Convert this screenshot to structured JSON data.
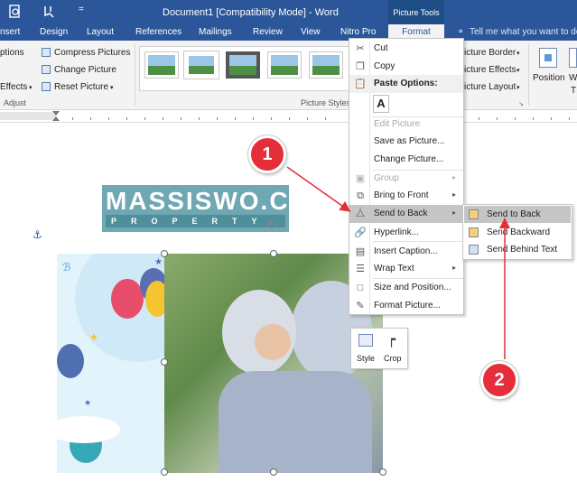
{
  "title_bar": {
    "document_title": "Document1 [Compatibility Mode] - Word",
    "contextual_group": "Picture Tools"
  },
  "ribbon_tabs": [
    "nsert",
    "Design",
    "Layout",
    "References",
    "Mailings",
    "Review",
    "View",
    "Nitro Pro",
    "Format"
  ],
  "tell_me": "Tell me what you want to do",
  "ribbon": {
    "adjust": {
      "group_label": "Adjust",
      "items": [
        "ptions",
        "Effects",
        "Compress Pictures",
        "Change Picture",
        "Reset Picture"
      ]
    },
    "picture_styles": {
      "group_label": "Picture Styles"
    },
    "right_items": [
      "icture Border",
      "icture Effects",
      "icture Layout"
    ],
    "position_label": "Position",
    "wrap_label_fragment": "W",
    "wrap_label_fragment2": "T"
  },
  "logo": {
    "line1": "MASSISWO.COM",
    "line2": "PROPERTY"
  },
  "context_menu": {
    "items": [
      {
        "label": "Cut",
        "icon": "scissors-icon",
        "disabled": false,
        "submenu": false
      },
      {
        "label": "Copy",
        "icon": "copy-icon",
        "disabled": false,
        "submenu": false
      },
      {
        "label": "Paste Options:",
        "icon": "paste-icon",
        "disabled": false,
        "submenu": false
      },
      {
        "label": "Edit Picture",
        "icon": "",
        "disabled": true,
        "submenu": false
      },
      {
        "label": "Save as Picture...",
        "icon": "",
        "disabled": false,
        "submenu": false
      },
      {
        "label": "Change Picture...",
        "icon": "",
        "disabled": false,
        "submenu": false
      },
      {
        "label": "Group",
        "icon": "group-icon",
        "disabled": true,
        "submenu": true
      },
      {
        "label": "Bring to Front",
        "icon": "bring-front-icon",
        "disabled": false,
        "submenu": true
      },
      {
        "label": "Send to Back",
        "icon": "send-back-icon",
        "disabled": false,
        "submenu": true
      },
      {
        "label": "Hyperlink...",
        "icon": "hyperlink-icon",
        "disabled": false,
        "submenu": false
      },
      {
        "label": "Insert Caption...",
        "icon": "caption-icon",
        "disabled": false,
        "submenu": false
      },
      {
        "label": "Wrap Text",
        "icon": "wrap-text-icon",
        "disabled": false,
        "submenu": true
      },
      {
        "label": "Size and Position...",
        "icon": "size-icon",
        "disabled": false,
        "submenu": false
      },
      {
        "label": "Format Picture...",
        "icon": "format-picture-icon",
        "disabled": false,
        "submenu": false
      }
    ]
  },
  "submenu": {
    "items": [
      "Send to Back",
      "Send Backward",
      "Send Behind Text"
    ]
  },
  "mini_toolbar": {
    "style_label": "Style",
    "crop_label": "Crop"
  },
  "annotations": {
    "step1": "1",
    "step2": "2"
  },
  "colors": {
    "word_blue": "#2b579a",
    "annotation_red": "#e52e3a",
    "menu_highlight": "#c5c5c5"
  }
}
